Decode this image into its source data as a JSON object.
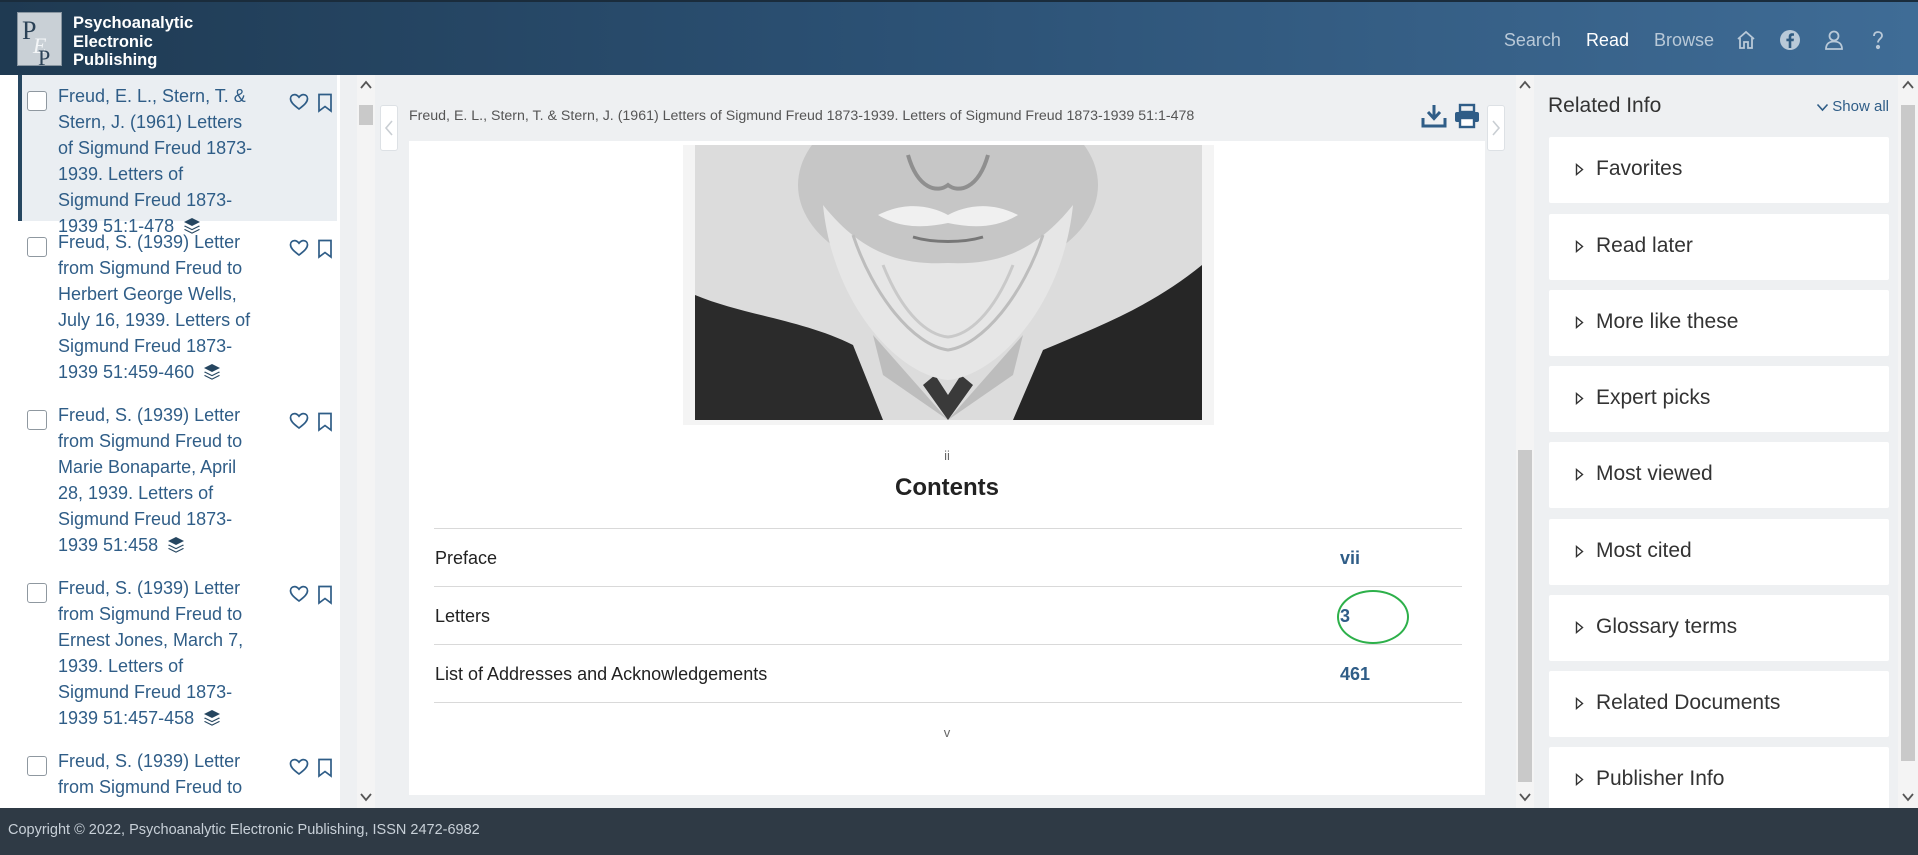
{
  "header": {
    "logo_lines": [
      "Psychoanalytic",
      "Electronic",
      "Publishing"
    ],
    "logo_mark": "PEP",
    "nav": {
      "search": "Search",
      "read": "Read",
      "browse": "Browse"
    },
    "icons": [
      "home-icon",
      "facebook-icon",
      "user-icon",
      "help-icon"
    ]
  },
  "results": {
    "items": [
      {
        "text": "Freud, E. L., Stern, T. & Stern, J. (1961) Letters of Sigmund Freud 1873-1939. Letters of Sigmund Freud 1873-1939 51:1-478",
        "selected": true
      },
      {
        "text": "Freud, S. (1939) Letter from Sigmund Freud to Herbert George Wells, July 16, 1939. Letters of Sigmund Freud 1873-1939 51:459-460",
        "selected": false
      },
      {
        "text": "Freud, S. (1939) Letter from Sigmund Freud to Marie Bonaparte, April 28, 1939. Letters of Sigmund Freud 1873-1939 51:458",
        "selected": false
      },
      {
        "text": "Freud, S. (1939) Letter from Sigmund Freud to Ernest Jones, March 7, 1939. Letters of Sigmund Freud 1873-1939 51:457-458",
        "selected": false
      },
      {
        "text": "Freud, S. (1939) Letter from Sigmund Freud to",
        "selected": false
      }
    ]
  },
  "document": {
    "citation": "Freud, E. L., Stern, T. & Stern, J. (1961) Letters of Sigmund Freud 1873-1939. Letters of Sigmund Freud 1873-1939 51:1-478",
    "page_ii": "ii",
    "contents_title": "Contents",
    "contents": [
      {
        "label": "Preface",
        "page": "vii"
      },
      {
        "label": "Letters",
        "page": "3"
      },
      {
        "label": "List of Addresses and Acknowledgements",
        "page": "461"
      }
    ],
    "page_v": "v"
  },
  "related": {
    "title": "Related Info",
    "show_all": "Show all",
    "sections": [
      "Favorites",
      "Read later",
      "More like these",
      "Expert picks",
      "Most viewed",
      "Most cited",
      "Glossary terms",
      "Related Documents",
      "Publisher Info"
    ]
  },
  "footer": {
    "copyright": "Copyright © 2022, Psychoanalytic Electronic Publishing, ISSN 2472-6982"
  },
  "colors": {
    "accent": "#2f5d87",
    "header": "#2b5073",
    "highlight_circle": "#2db04a",
    "footer": "#2f3a45"
  }
}
